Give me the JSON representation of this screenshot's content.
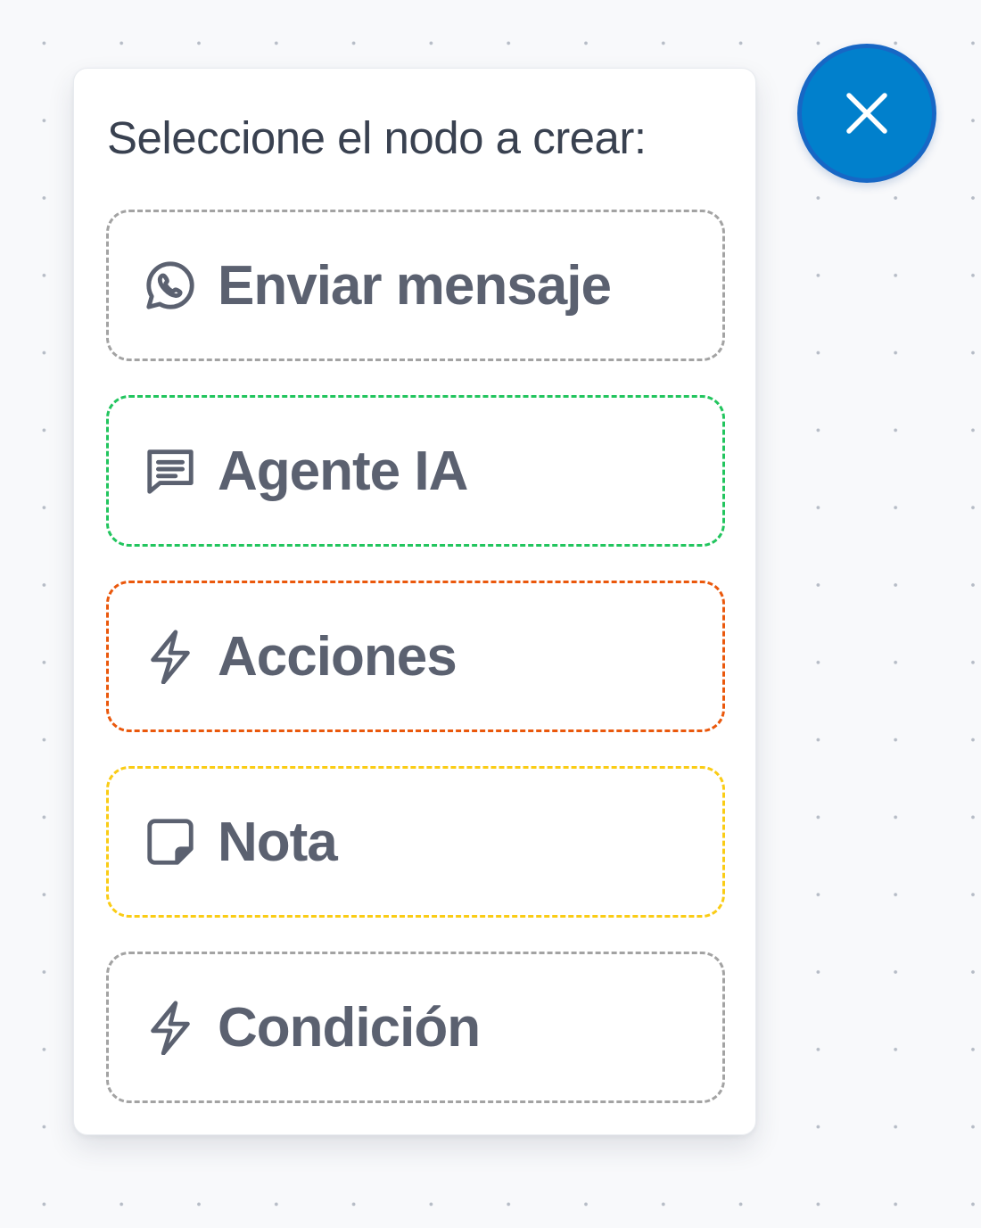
{
  "node_menu": {
    "title": "Seleccione el nodo a crear:",
    "options": [
      {
        "label": "Enviar mensaje",
        "icon": "whatsapp-icon",
        "border_color": "#a3a3a3"
      },
      {
        "label": "Agente IA",
        "icon": "message-icon",
        "border_color": "#22c55e"
      },
      {
        "label": "Acciones",
        "icon": "lightning-icon",
        "border_color": "#ea580c"
      },
      {
        "label": "Nota",
        "icon": "sticky-note-icon",
        "border_color": "#facc15"
      },
      {
        "label": "Condición",
        "icon": "lightning-icon",
        "border_color": "#a3a3a3"
      }
    ]
  },
  "close_button": {
    "icon": "close-icon",
    "color": "#0180cc"
  }
}
